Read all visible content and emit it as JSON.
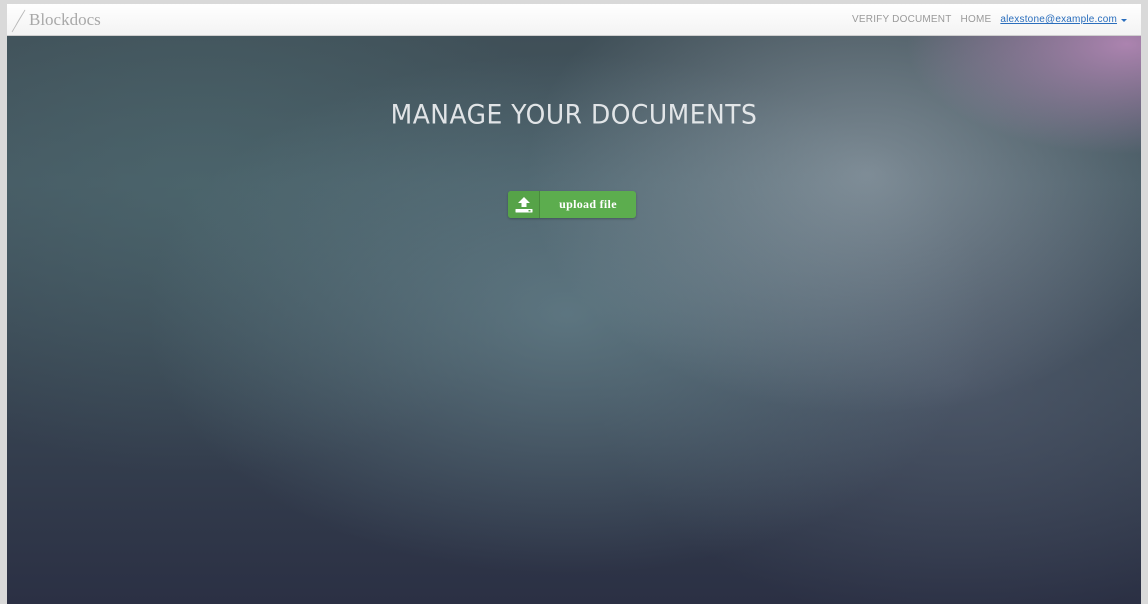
{
  "navbar": {
    "brand": "Blockdocs",
    "brand_icon": "feather-logo",
    "links": [
      "VERIFY DOCUMENT",
      "HOME"
    ],
    "user_email": "alexstone@example.com"
  },
  "hero": {
    "title": "MANAGE YOUR DOCUMENTS"
  },
  "upload": {
    "label": "upload file",
    "icon": "upload-icon",
    "color": "#5cad4e"
  }
}
